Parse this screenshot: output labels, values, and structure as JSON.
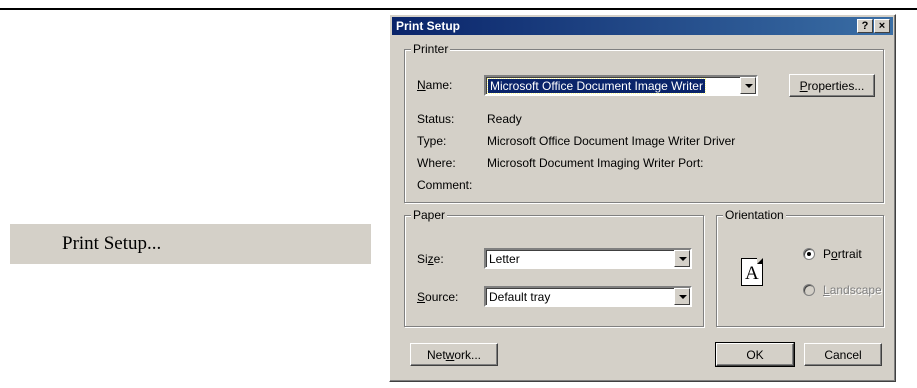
{
  "menu": {
    "item_label": "Print Setup..."
  },
  "dialog": {
    "title": "Print Setup",
    "help_button": "?",
    "close_button": "×",
    "printer": {
      "group_label": "Printer",
      "name_label_u": "N",
      "name_label_rest": "ame:",
      "name_value": "Microsoft Office Document Image Writer",
      "properties_u": "P",
      "properties_rest": "roperties...",
      "status_label": "Status:",
      "status_value": "Ready",
      "type_label": "Type:",
      "type_value": "Microsoft Office Document Image Writer Driver",
      "where_label": "Where:",
      "where_value": "Microsoft Document Imaging Writer Port:",
      "comment_label": "Comment:",
      "comment_value": ""
    },
    "paper": {
      "group_label": "Paper",
      "size_label_pre": "Si",
      "size_label_u": "z",
      "size_label_post": "e:",
      "size_value": "Letter",
      "source_label_u": "S",
      "source_label_rest": "ource:",
      "source_value": "Default tray"
    },
    "orientation": {
      "group_label": "Orientation",
      "icon_letter": "A",
      "portrait_pre": "P",
      "portrait_u": "o",
      "portrait_post": "rtrait",
      "portrait_checked": true,
      "landscape_u": "L",
      "landscape_rest": "andscape",
      "landscape_enabled": false
    },
    "buttons": {
      "network_pre": "Net",
      "network_u": "w",
      "network_post": "ork...",
      "ok": "OK",
      "cancel": "Cancel"
    }
  }
}
